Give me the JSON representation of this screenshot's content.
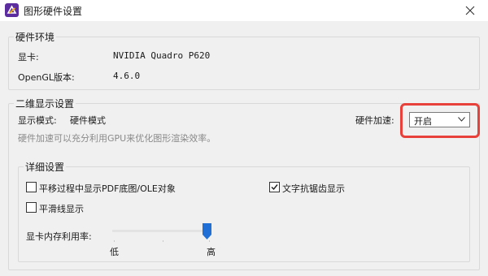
{
  "window": {
    "title": "图形硬件设置"
  },
  "hardware_env": {
    "group_title": "硬件环境",
    "rows": [
      {
        "label": "显卡:",
        "value": "NVIDIA Quadro P620"
      },
      {
        "label": "OpenGL版本:",
        "value": "4.6.0"
      }
    ]
  },
  "display_2d": {
    "group_title": "二维显示设置",
    "mode_label": "显示模式:",
    "mode_value": "硬件模式",
    "accel_label": "硬件加速:",
    "accel_value": "开启",
    "hint": "硬件加速可以充分利用GPU来优化图形渲染效率。",
    "details": {
      "group_title": "详细设置",
      "options": [
        {
          "label": "平移过程中显示PDF底图/OLE对象",
          "checked": false
        },
        {
          "label": "文字抗锯齿显示",
          "checked": true
        },
        {
          "label": "平滑线显示",
          "checked": false
        }
      ],
      "memory": {
        "label": "显卡内存利用率:",
        "min_label": "低",
        "max_label": "高",
        "level": 1.0
      }
    }
  },
  "colors": {
    "highlight": "#e8403a",
    "slider_thumb": "#1f6fd6",
    "accent": "#5b2d9f"
  },
  "icons": {
    "app": "app-logo-icon",
    "close": "close-icon",
    "dropdown": "chevron-down-icon",
    "check": "checkmark-icon"
  }
}
